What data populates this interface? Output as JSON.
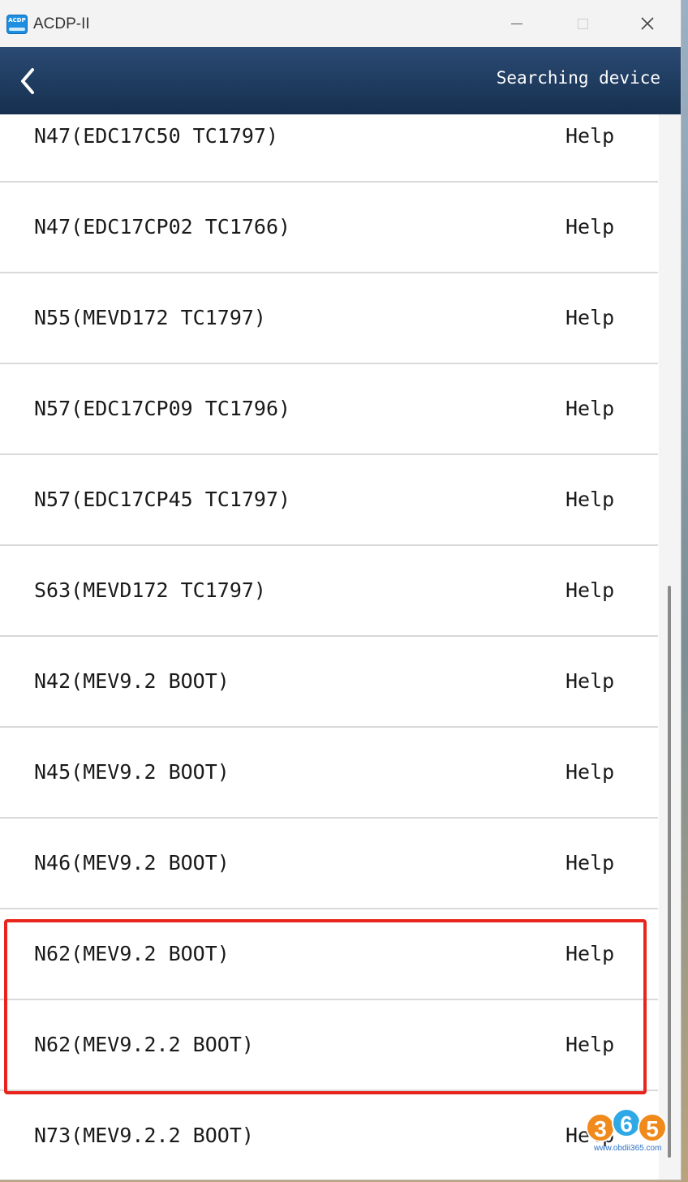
{
  "window": {
    "title": "ACDP-II",
    "icon_text": "ACDP",
    "controls": [
      "minimize-icon",
      "maximize-icon",
      "close-icon"
    ]
  },
  "header": {
    "back_icon": "chevron-left-icon",
    "status": "Searching device"
  },
  "list": {
    "items": [
      {
        "label": "N47(EDC17C50 TC1797)",
        "help": "Help"
      },
      {
        "label": "N47(EDC17CP02 TC1766)",
        "help": "Help"
      },
      {
        "label": "N55(MEVD172 TC1797)",
        "help": "Help"
      },
      {
        "label": "N57(EDC17CP09 TC1796)",
        "help": "Help"
      },
      {
        "label": "N57(EDC17CP45 TC1797)",
        "help": "Help"
      },
      {
        "label": "S63(MEVD172 TC1797)",
        "help": "Help"
      },
      {
        "label": "N42(MEV9.2 BOOT)",
        "help": "Help"
      },
      {
        "label": "N45(MEV9.2 BOOT)",
        "help": "Help"
      },
      {
        "label": "N46(MEV9.2 BOOT)",
        "help": "Help"
      },
      {
        "label": "N62(MEV9.2 BOOT)",
        "help": "Help"
      },
      {
        "label": "N62(MEV9.2.2 BOOT)",
        "help": "Help"
      },
      {
        "label": "N73(MEV9.2.2 BOOT)",
        "help": "Help"
      }
    ],
    "highlighted_items": [
      "N62(MEV9.2 BOOT)",
      "N62(MEV9.2.2 BOOT)"
    ],
    "highlight_color": "#e8251c"
  },
  "watermark": {
    "digits": [
      "3",
      "6",
      "5"
    ],
    "url": "www.obdii365.com"
  },
  "colors": {
    "header_top": "#2b4a73",
    "header_bottom": "#15304f",
    "text": "#1a1a1a",
    "divider": "#d9d9d9"
  }
}
